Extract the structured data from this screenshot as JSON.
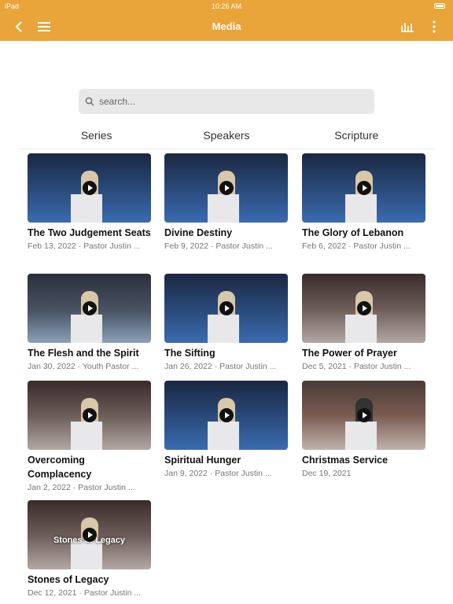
{
  "status": {
    "device": "iPad",
    "time": "10:26 AM"
  },
  "nav": {
    "title": "Media"
  },
  "search": {
    "placeholder": "search..."
  },
  "tabs": [
    "Series",
    "Speakers",
    "Scripture"
  ],
  "items": [
    {
      "title": "The Two Judgement Seats",
      "date": "Feb 13, 2022",
      "speaker": "Pastor Justin ...",
      "scene": "blue"
    },
    {
      "title": "Divine Destiny",
      "date": "Feb 9, 2022",
      "speaker": "Pastor Justin ...",
      "scene": "blue"
    },
    {
      "title": "The Glory of Lebanon",
      "date": "Feb 6, 2022",
      "speaker": "Pastor Justin ...",
      "scene": "blue"
    },
    {
      "title": "The Flesh and the Spirit",
      "date": "Jan 30, 2022",
      "speaker": "Youth Pastor ...",
      "scene": "stage"
    },
    {
      "title": "The Sifting",
      "date": "Jan 26, 2022",
      "speaker": "Pastor Justin ...",
      "scene": "blue"
    },
    {
      "title": "The Power of Prayer",
      "date": "Dec 5, 2021",
      "speaker": "Pastor Justin ...",
      "scene": "warm"
    },
    {
      "title": "Overcoming Complacency",
      "date": "Jan 2, 2022",
      "speaker": "Pastor Justin ...",
      "scene": "warm"
    },
    {
      "title": "Spiritual Hunger",
      "date": "Jan 9, 2022",
      "speaker": "Pastor Justin ...",
      "scene": "blue"
    },
    {
      "title": "Christmas Service",
      "date": "Dec 19, 2021",
      "speaker": "",
      "scene": "red"
    },
    {
      "title": "Stones of Legacy",
      "date": "Dec 12, 2021",
      "speaker": "Pastor Justin ...",
      "scene": "warm",
      "overlay": "Stones of Legacy"
    }
  ],
  "colors": {
    "accent": "#e9a43a"
  }
}
